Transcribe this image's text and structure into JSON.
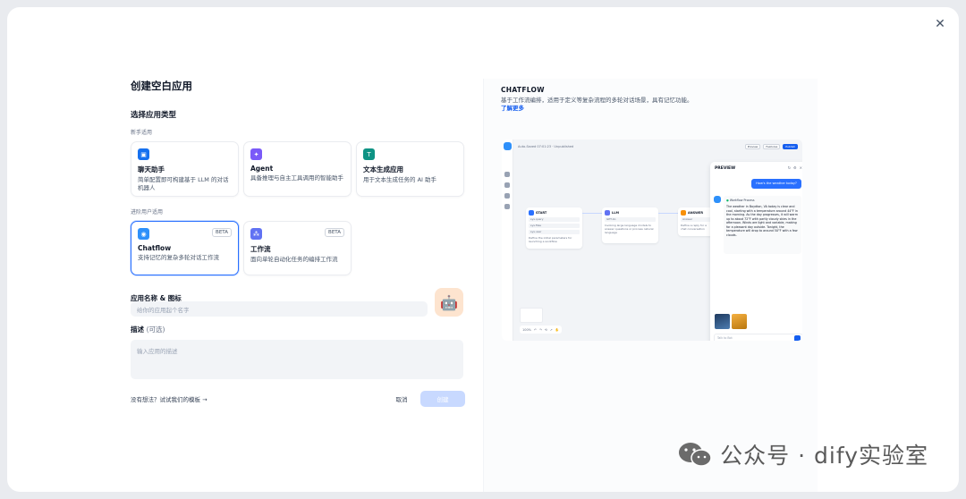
{
  "dialog": {
    "title": "创建空白应用",
    "close_icon": "close-icon"
  },
  "app_type": {
    "section_title": "选择应用类型",
    "beginner_label": "新手适用",
    "advanced_label": "进阶用户适用",
    "beginner_cards": [
      {
        "title": "聊天助手",
        "desc": "简单配置即可构建基于 LLM 的对话机器人",
        "icon": "chat-bubble-icon",
        "color": "#1570ef"
      },
      {
        "title": "Agent",
        "desc": "具备推理与自主工具调用的智能助手",
        "icon": "agent-icon",
        "color": "#7a5af8"
      },
      {
        "title": "文本生成应用",
        "desc": "用于文本生成任务的 AI 助手",
        "icon": "text-generation-icon",
        "color": "#0e9384"
      }
    ],
    "advanced_cards": [
      {
        "title": "Chatflow",
        "desc": "支持记忆的复杂多轮对话工作流",
        "badge": "BETA",
        "icon": "chatflow-icon",
        "color": "#2e90fa"
      },
      {
        "title": "工作流",
        "desc": "面向单轮自动化任务的编排工作流",
        "badge": "BETA",
        "icon": "workflow-icon",
        "color": "#6172f3"
      }
    ]
  },
  "form": {
    "name_label": "应用名称 & 图标",
    "name_placeholder": "给你的应用起个名字",
    "avatar_emoji": "🤖",
    "desc_label": "描述",
    "desc_optional": "(可选)",
    "desc_placeholder": "输入应用的描述"
  },
  "footer": {
    "template_link": "没有想法？试试我们的模板 →",
    "cancel_label": "取消",
    "create_label": "创建"
  },
  "preview": {
    "type": "CHATFLOW",
    "desc": "基于工作流编排，适用于定义等复杂流程的多轮对话场景，具有记忆功能。",
    "learn_more": "了解更多",
    "screenshot": {
      "topbar_text": "Auto-Saved 07:01:23 · Unpublished",
      "toolbar": [
        "Preview",
        "Features",
        "Publish"
      ],
      "nodes": [
        {
          "title": "START",
          "rows": [
            "sys.query",
            "sys.files",
            "sys.user"
          ],
          "note": "Define the initial parameters for launching a workflow"
        },
        {
          "title": "LLM",
          "rows": [
            "GPT-4o"
          ],
          "note": "Invoking large language models to answer questions or process natural language"
        },
        {
          "title": "ANSWER",
          "rows": [
            "Answer"
          ],
          "note": "Define a reply for a chat conversation"
        }
      ],
      "chat_panel": {
        "title": "PREVIEW",
        "user_message": "How's the weather today?",
        "workflow_tag": "Workflow Process",
        "bot_message": "The weather in Boydton, VA today is clear and cool, starting with a temperature around 44°F in the morning. As the day progresses, it will warm up to about 72°F with partly cloudy skies in the afternoon. Winds are light and variable, making for a pleasant day outside. Tonight, the temperature will drop to around 50°F with a few clouds.",
        "input_placeholder": "Talk to Bot",
        "zoom": "100%"
      }
    }
  },
  "watermark": {
    "text": "公众号 · dify实验室"
  }
}
